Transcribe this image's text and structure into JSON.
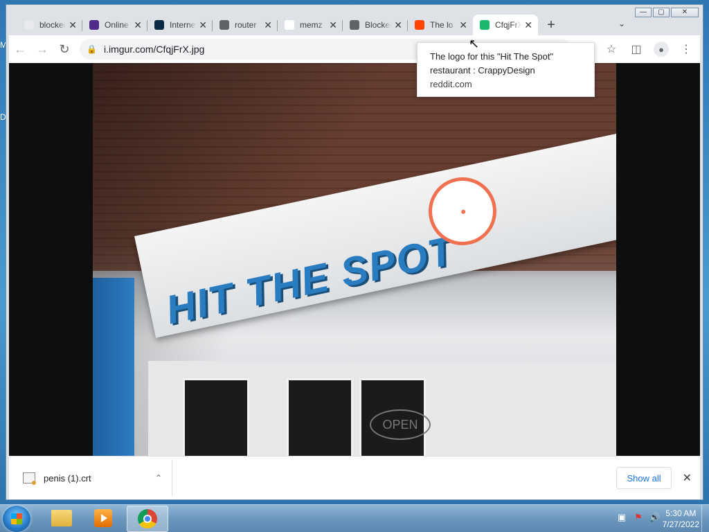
{
  "desktop": {
    "label_m": "M",
    "label_d": "D"
  },
  "window": {
    "minimize": "—",
    "maximize": "▢",
    "close": "✕"
  },
  "tabs": [
    {
      "title": "blocked",
      "favicon": "rainbow-icon",
      "fav_color": "#e8eaed"
    },
    {
      "title": "Online",
      "favicon": "onenote-icon",
      "fav_color": "#4b2a8a"
    },
    {
      "title": "Internet",
      "favicon": "internet-archive-icon",
      "fav_color": "#0b2a45"
    },
    {
      "title": "router",
      "favicon": "globe-icon",
      "fav_color": "#5f6368"
    },
    {
      "title": "memz",
      "favicon": "google-icon",
      "fav_color": "#ffffff"
    },
    {
      "title": "Blocked",
      "favicon": "globe-icon",
      "fav_color": "#5f6368"
    },
    {
      "title": "The lo",
      "favicon": "reddit-icon",
      "fav_color": "#ff4500"
    },
    {
      "title": "CfqjFrX",
      "favicon": "imgur-icon",
      "fav_color": "#1bb76e",
      "active": true
    }
  ],
  "toolbar": {
    "url": "i.imgur.com/CfqjFrX.jpg"
  },
  "tooltip": {
    "line1": "The logo for this \"Hit The Spot\"",
    "line2": "restaurant : CrappyDesign",
    "host": "reddit.com"
  },
  "image": {
    "sign_text": "HIT THE SPOT",
    "open_text": "OPEN"
  },
  "download": {
    "filename": "penis (1).crt",
    "show_all": "Show all"
  },
  "taskbar": {
    "time": "5:30 AM",
    "date": "7/27/2022"
  }
}
